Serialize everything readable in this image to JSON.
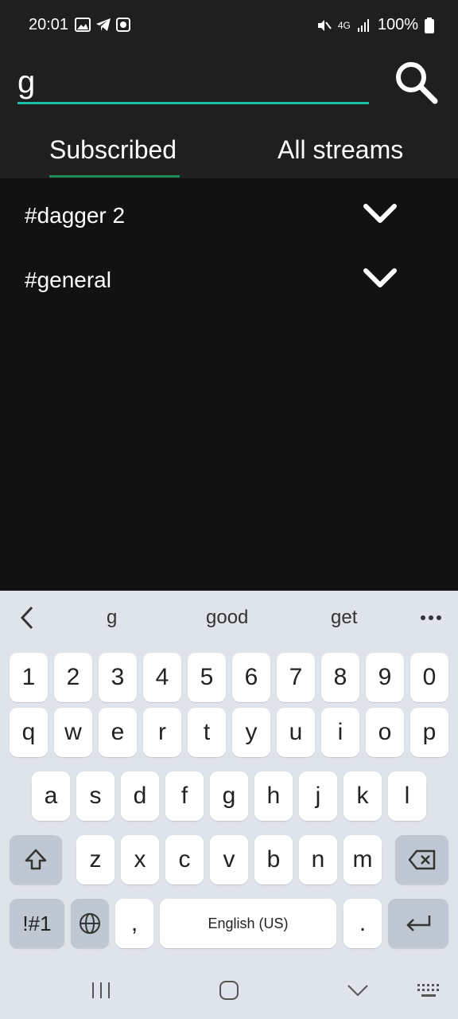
{
  "status_bar": {
    "time": "20:01",
    "network": "4G",
    "battery": "100%"
  },
  "search": {
    "value": "g",
    "placeholder": "",
    "button_icon": "search-icon"
  },
  "tabs": [
    {
      "label": "Subscribed",
      "active": true
    },
    {
      "label": "All streams",
      "active": false
    }
  ],
  "streams": [
    {
      "name": "#dagger 2",
      "expand_icon": "chevron-down-icon"
    },
    {
      "name": "#general",
      "expand_icon": "chevron-down-icon"
    }
  ],
  "keyboard": {
    "suggestions": [
      "g",
      "good",
      "get"
    ],
    "row_numbers": [
      "1",
      "2",
      "3",
      "4",
      "5",
      "6",
      "7",
      "8",
      "9",
      "0"
    ],
    "row1": [
      "q",
      "w",
      "e",
      "r",
      "t",
      "y",
      "u",
      "i",
      "o",
      "p"
    ],
    "row2": [
      "a",
      "s",
      "d",
      "f",
      "g",
      "h",
      "j",
      "k",
      "l"
    ],
    "row3": [
      "z",
      "x",
      "c",
      "v",
      "b",
      "n",
      "m"
    ],
    "symbols_label": "!#1",
    "comma": ",",
    "space_label": "English (US)",
    "period": "."
  },
  "colors": {
    "accent": "#1dbfa4",
    "tab_indicator": "#1e8a55",
    "background": "#121212",
    "header": "#1f1f1f"
  }
}
